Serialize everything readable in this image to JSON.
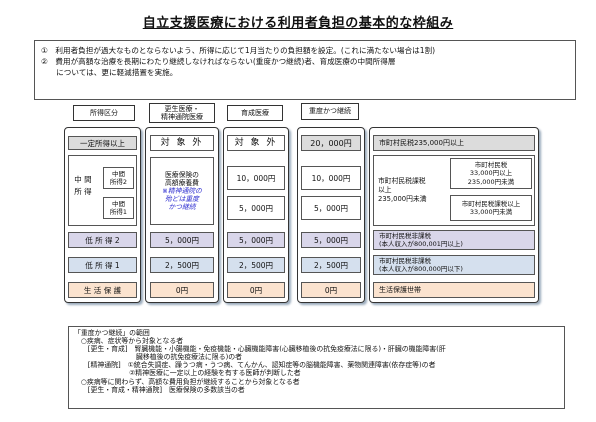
{
  "title": "自立支援医療における利用者負担の基本的な枠組み",
  "notes": [
    "①　利用者負担が過大なものとならないよう、所得に応じて1月当たりの負担額を設定。(これに満たない場合は1割)",
    "②　費用が高額な治療を長期にわたり継続しなければならない(重度かつ継続)者、育成医療の中間所得層",
    "　　については、更に軽減措置を実施。"
  ],
  "headers": {
    "income": "所得区分",
    "kosei": "更生医療・\n精神通院医療",
    "ikusei": "育成医療",
    "juudo": "重度かつ継続"
  },
  "income_labels": {
    "ittei": "一定所得以上",
    "chukan": "中 間\n所 得",
    "chukan2": "中間\n所得2",
    "chukan1": "中間\n所得1",
    "tei2": "低 所 得 2",
    "tei1": "低 所 得 1",
    "seikatsu": "生 活 保 護"
  },
  "kosei": {
    "ittei": "対 象 外",
    "chukan_main": "医療保険の\n高額療養費",
    "chukan_note": "※精神通院の\n殆どは重度\nかつ継続",
    "tei2": "5，000円",
    "tei1": "2，500円",
    "seikatsu": "0円"
  },
  "ikusei": {
    "ittei": "対 象 外",
    "chukan2": "10，000円",
    "chukan1": "5，000円",
    "tei2": "5，000円",
    "tei1": "2，500円",
    "seikatsu": "0円"
  },
  "juudo": {
    "ittei": "20，000円",
    "chukan2": "10，000円",
    "chukan1": "5，000円",
    "tei2": "5，000円",
    "tei1": "2，500円",
    "seikatsu": "0円"
  },
  "criteria": {
    "ittei": "市町村民税235,000円以上",
    "chukan_left": "市町村民税課税\n以上\n235,000円未満",
    "chukan_top": "市町村民税\n33,000円以上\n235,000円未満",
    "chukan_bottom": "市町村民税課税以上\n33,000円未満",
    "tei2": "市町村民税非課税\n(本人収入が800,001円以上)",
    "tei1": "市町村民税非課税\n(本人収入が800,000円以下)",
    "seikatsu": "生活保護世帯"
  },
  "bottom_lines": [
    "「重度かつ継続」の範囲",
    "　○疾病、症状等から対象となる者",
    "　　[更生・育成]　腎臓機能・小腸機能・免疫機能・心臓機能障害(心臓移植後の抗免疫療法に限る)・肝臓の機能障害(肝",
    "　　　　　　　　　臓移植後の抗免疫療法に限る)の者",
    "　　[精神通院]　①統合失調症、躁うつ病・うつ病、てんかん、認知症等の脳機能障害、薬物関連障害(依存症等)の者",
    "　　　　　　　　②精神医療に一定以上の経験を有する医師が判断した者",
    "　○疾病等に関わらず、高額な費用負担が継続することから対象となる者",
    "　　[更生・育成・精神通院]　医療保険の多数該当の者"
  ]
}
